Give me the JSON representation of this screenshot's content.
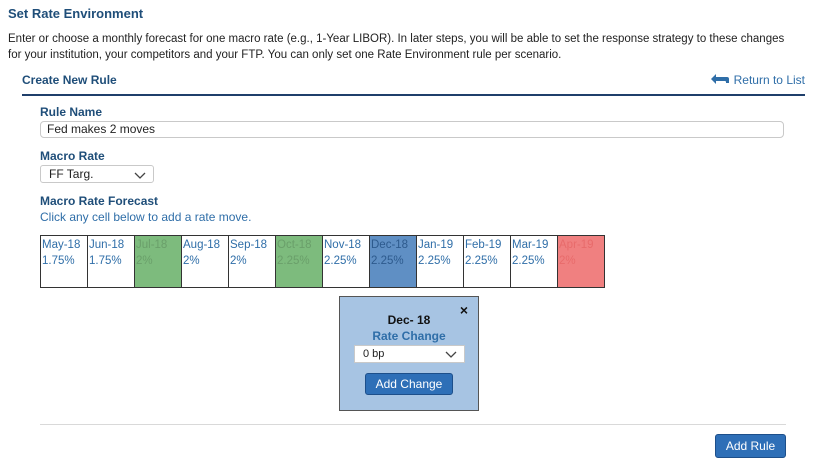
{
  "page": {
    "title": "Set Rate Environment",
    "intro": "Enter or choose a monthly forecast for one macro rate (e.g., 1-Year LIBOR). In later steps, you will be able to set the response strategy to these changes for your institution, your competitors and your FTP. You can only set one Rate Environment rule per scenario."
  },
  "section": {
    "title": "Create New Rule",
    "return_link": "Return to List",
    "return_icon": "return-arrow-icon"
  },
  "form": {
    "rule_name_label": "Rule Name",
    "rule_name_value": "Fed makes 2 moves",
    "macro_rate_label": "Macro Rate",
    "macro_rate_value": "FF Targ.",
    "forecast_label": "Macro Rate Forecast",
    "forecast_hint": "Click any cell below to add a rate move."
  },
  "forecast": [
    {
      "month": "May-18",
      "rate": "1.75%",
      "state": "none"
    },
    {
      "month": "Jun-18",
      "rate": "1.75%",
      "state": "none"
    },
    {
      "month": "Jul-18",
      "rate": "2%",
      "state": "green"
    },
    {
      "month": "Aug-18",
      "rate": "2%",
      "state": "none"
    },
    {
      "month": "Sep-18",
      "rate": "2%",
      "state": "none"
    },
    {
      "month": "Oct-18",
      "rate": "2.25%",
      "state": "green"
    },
    {
      "month": "Nov-18",
      "rate": "2.25%",
      "state": "none"
    },
    {
      "month": "Dec-18",
      "rate": "2.25%",
      "state": "blue"
    },
    {
      "month": "Jan-19",
      "rate": "2.25%",
      "state": "none"
    },
    {
      "month": "Feb-19",
      "rate": "2.25%",
      "state": "none"
    },
    {
      "month": "Mar-19",
      "rate": "2.25%",
      "state": "none"
    },
    {
      "month": "Apr-19",
      "rate": "2%",
      "state": "red"
    }
  ],
  "popup": {
    "title": "Dec- 18",
    "subtitle": "Rate Change",
    "select_value": "0 bp",
    "button_label": "Add Change",
    "close_label": "×"
  },
  "footer": {
    "add_rule_label": "Add Rule"
  },
  "colors": {
    "heading": "#1f4e79",
    "link": "#2f6ea8",
    "button": "#2e6fb7",
    "cell_green": "#7dbb7d",
    "cell_blue": "#5f8fc4",
    "cell_red": "#f08080",
    "popup_bg": "#a7c4e3"
  }
}
